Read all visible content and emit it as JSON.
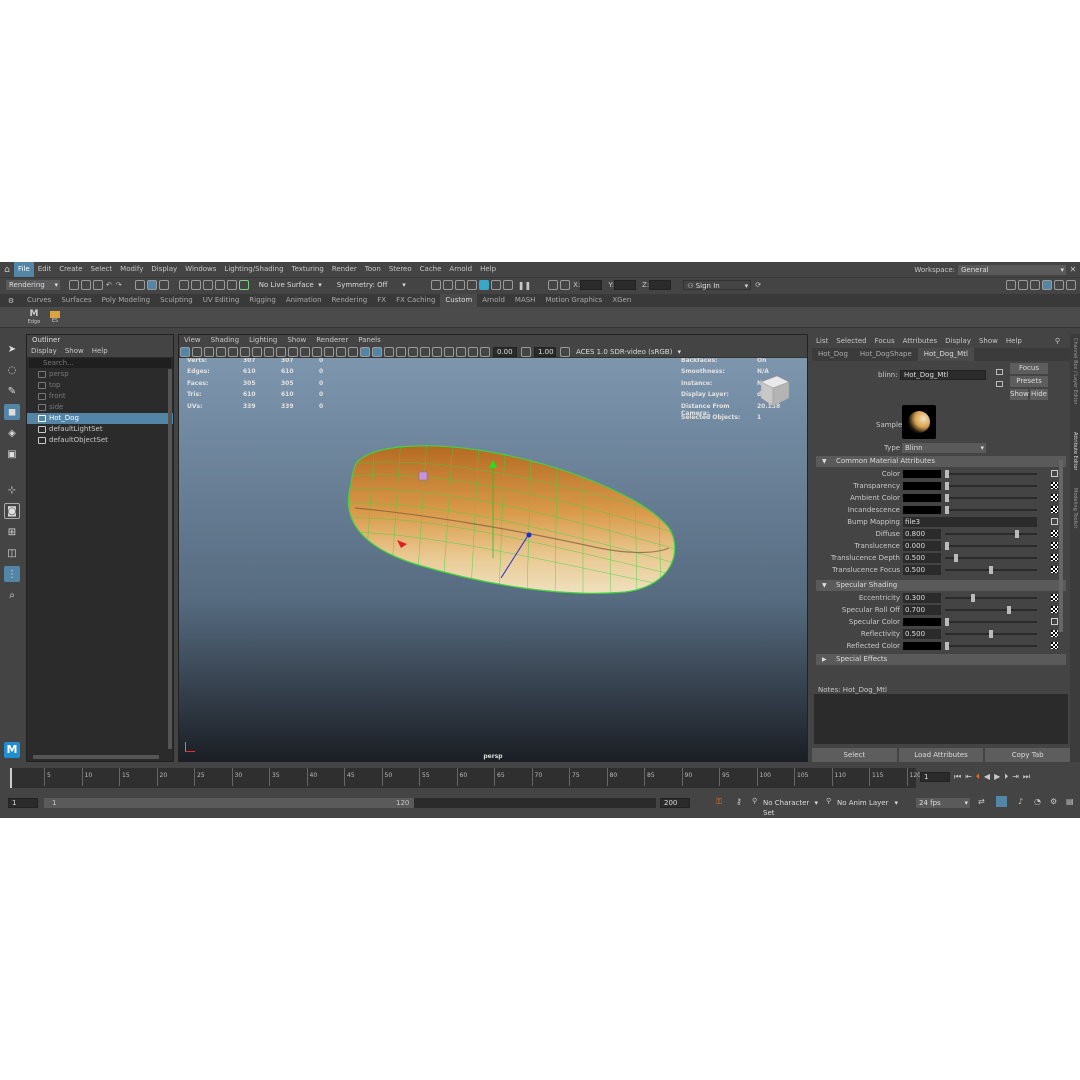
{
  "menubar": {
    "items": [
      "File",
      "Edit",
      "Create",
      "Select",
      "Modify",
      "Display",
      "Windows",
      "Lighting/Shading",
      "Texturing",
      "Render",
      "Toon",
      "Stereo",
      "Cache",
      "Arnold",
      "Help"
    ],
    "workspace_label": "Workspace:",
    "workspace_value": "General"
  },
  "statusline": {
    "menuset": "Rendering",
    "live_surface": "No Live Surface",
    "symmetry": "Symmetry: Off",
    "x_label": "X:",
    "y_label": "Y:",
    "z_label": "Z:",
    "sign_in": "Sign In"
  },
  "shelf": {
    "tabs": [
      "Curves",
      "Surfaces",
      "Poly Modeling",
      "Sculpting",
      "UV Editing",
      "Rigging",
      "Animation",
      "Rendering",
      "FX",
      "FX Caching",
      "Custom",
      "Arnold",
      "MASH",
      "Motion Graphics",
      "XGen"
    ],
    "active_tab": "Custom",
    "items": [
      {
        "label": "Edge",
        "icon": "maya-m-icon"
      },
      {
        "label": "ES",
        "icon": "folder-icon"
      }
    ]
  },
  "outliner": {
    "title": "Outliner",
    "menus": [
      "Display",
      "Show",
      "Help"
    ],
    "search_placeholder": "Search...",
    "items": [
      {
        "label": "persp",
        "dim": true
      },
      {
        "label": "top",
        "dim": true
      },
      {
        "label": "front",
        "dim": true
      },
      {
        "label": "side",
        "dim": true
      },
      {
        "label": "Hot_Dog",
        "selected": true
      },
      {
        "label": "defaultLightSet"
      },
      {
        "label": "defaultObjectSet"
      }
    ]
  },
  "viewport": {
    "menus": [
      "View",
      "Shading",
      "Lighting",
      "Show",
      "Renderer",
      "Panels"
    ],
    "exposure": "0.00",
    "gamma": "1.00",
    "color_space": "ACES 1.0 SDR-video (sRGB)",
    "camera": "persp",
    "hud_left": [
      {
        "k": "Verts:",
        "a": "307",
        "b": "307",
        "c": "0"
      },
      {
        "k": "Edges:",
        "a": "610",
        "b": "610",
        "c": "0"
      },
      {
        "k": "Faces:",
        "a": "305",
        "b": "305",
        "c": "0"
      },
      {
        "k": "Tris:",
        "a": "610",
        "b": "610",
        "c": "0"
      },
      {
        "k": "UVs:",
        "a": "339",
        "b": "339",
        "c": "0"
      }
    ],
    "hud_right": [
      {
        "k": "Backfaces:",
        "v": "On"
      },
      {
        "k": "Smoothness:",
        "v": "N/A"
      },
      {
        "k": "Instance:",
        "v": "No"
      },
      {
        "k": "Display Layer:",
        "v": "default"
      },
      {
        "k": "Distance From Camera:",
        "v": "20.138"
      },
      {
        "k": "Selected Objects:",
        "v": "1"
      }
    ]
  },
  "attribute_editor": {
    "menus": [
      "List",
      "Selected",
      "Focus",
      "Attributes",
      "Display",
      "Show",
      "Help"
    ],
    "tabs": [
      "Hot_Dog",
      "Hot_DogShape",
      "Hot_Dog_Mtl"
    ],
    "active_tab": "Hot_Dog_Mtl",
    "node_type_label": "blinn:",
    "node_name": "Hot_Dog_Mtl",
    "focus_btn": "Focus",
    "presets_btn": "Presets",
    "show_btn": "Show",
    "hide_btn": "Hide",
    "sample_label": "Sample",
    "type_label": "Type",
    "type_value": "Blinn",
    "common_section": "Common Material Attributes",
    "common": [
      {
        "label": "Color",
        "kind": "swatch",
        "knob": 0.0
      },
      {
        "label": "Transparency",
        "kind": "swatch",
        "knob": 0.0
      },
      {
        "label": "Ambient Color",
        "kind": "swatch",
        "knob": 0.0
      },
      {
        "label": "Incandescence",
        "kind": "swatch",
        "knob": 0.0
      },
      {
        "label": "Bump Mapping",
        "kind": "text",
        "value": "file3"
      },
      {
        "label": "Diffuse",
        "kind": "num",
        "value": "0.800",
        "knob": 0.8
      },
      {
        "label": "Translucence",
        "kind": "num",
        "value": "0.000",
        "knob": 0.0
      },
      {
        "label": "Translucence Depth",
        "kind": "num",
        "value": "0.500",
        "knob": 0.1
      },
      {
        "label": "Translucence Focus",
        "kind": "num",
        "value": "0.500",
        "knob": 0.5
      }
    ],
    "specular_section": "Specular Shading",
    "specular": [
      {
        "label": "Eccentricity",
        "kind": "num",
        "value": "0.300",
        "knob": 0.3
      },
      {
        "label": "Specular Roll Off",
        "kind": "num",
        "value": "0.700",
        "knob": 0.7
      },
      {
        "label": "Specular Color",
        "kind": "swatch",
        "knob": 0.0
      },
      {
        "label": "Reflectivity",
        "kind": "num",
        "value": "0.500",
        "knob": 0.5
      },
      {
        "label": "Reflected Color",
        "kind": "swatch",
        "knob": 0.0
      }
    ],
    "special_section": "Special Effects",
    "notes": "Notes: Hot_Dog_Mtl",
    "bottom_buttons": [
      "Select",
      "Load Attributes",
      "Copy Tab"
    ],
    "side_tabs": [
      "Channel Box / Layer Editor",
      "Attribute Editor",
      "Modeling Toolkit"
    ]
  },
  "timeline": {
    "ticks": [
      "5",
      "10",
      "15",
      "20",
      "25",
      "30",
      "35",
      "40",
      "45",
      "50",
      "55",
      "60",
      "65",
      "70",
      "75",
      "80",
      "85",
      "90",
      "95",
      "100",
      "105",
      "110",
      "115",
      "120"
    ],
    "current_frame": "1"
  },
  "range": {
    "start": "1",
    "inner_start": "1",
    "inner_end": "120",
    "end": "200",
    "character_set": "No Character Set",
    "anim_layer": "No Anim Layer",
    "fps": "24 fps"
  },
  "colors": {
    "accent": "#5285a6",
    "bg": "#444444",
    "panel": "#2b2b2b"
  }
}
